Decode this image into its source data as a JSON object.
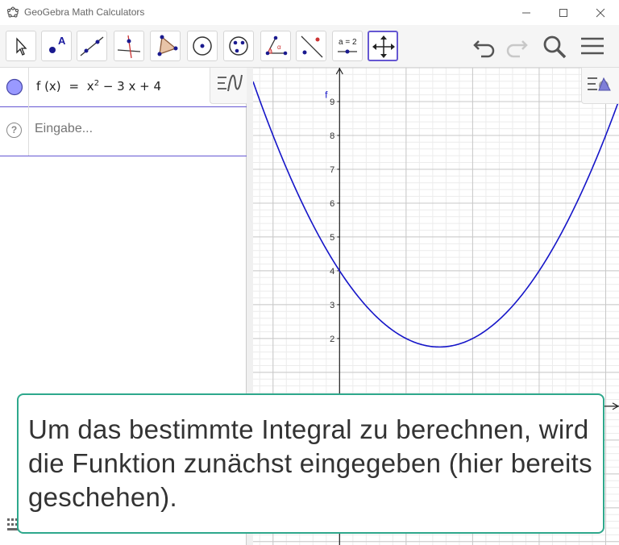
{
  "window": {
    "title": "GeoGebra Math Calculators"
  },
  "toolbar": {
    "tools": [
      {
        "name": "move-tool-icon"
      },
      {
        "name": "point-tool-icon",
        "glyph": "A"
      },
      {
        "name": "line-tool-icon"
      },
      {
        "name": "perpendicular-line-tool-icon"
      },
      {
        "name": "polygon-tool-icon"
      },
      {
        "name": "circle-center-tool-icon"
      },
      {
        "name": "circle-three-points-tool-icon"
      },
      {
        "name": "angle-tool-icon",
        "glyph": "α"
      },
      {
        "name": "reflect-tool-icon"
      },
      {
        "name": "slider-tool-icon",
        "glyph": "a = 2"
      },
      {
        "name": "move-graphics-view-tool-icon"
      }
    ]
  },
  "algebra": {
    "f_name": "f",
    "f_arg": "(x)",
    "eq": "=",
    "x_base": "x",
    "x_exp": "2",
    "rest": "− 3 x + 4",
    "input_placeholder": "Eingabe...",
    "help": "?"
  },
  "graph": {
    "function_label": "f",
    "y_ticks": [
      "9",
      "8",
      "7",
      "6",
      "5",
      "4",
      "3",
      "2"
    ],
    "curve_color": "#1515c8",
    "function": {
      "a": 1,
      "b": -3,
      "c": 4
    },
    "x_range": [
      -1.3,
      4.2
    ],
    "y_range": [
      -4.1,
      10.0
    ]
  },
  "caption": {
    "text": "Um das bestimmte Integral zu berechnen, wird die Funktion zunächst eingegeben (hier bereits geschehen)."
  },
  "colors": {
    "accent": "#6557d2",
    "point": "#9999ff",
    "caption_border": "#2ea88c"
  }
}
